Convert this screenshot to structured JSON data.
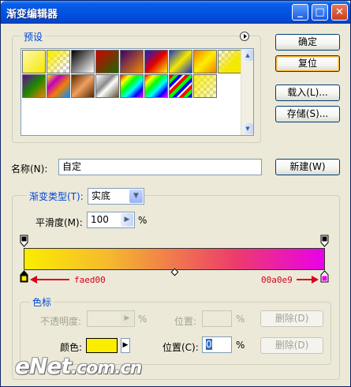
{
  "window": {
    "title": "渐变编辑器"
  },
  "titlebar_buttons": {
    "minimize": "_",
    "maximize": "□",
    "close": "✕"
  },
  "presets": {
    "title": "预设",
    "swatches_row1": [
      "fg-bg",
      "fg-transparent",
      "black-white",
      "red-green",
      "violet-orange",
      "blue-red-yellow",
      "blue-yellow-blue",
      "orange-yellow-orange",
      "yellow-transparent"
    ],
    "swatches_row2": [
      "violet-green-orange",
      "yellow-violet-orange-blue",
      "copper",
      "chrome",
      "rainbow",
      "transparent-rainbow",
      "transparent-stripes",
      "yellow-transparent-2"
    ]
  },
  "buttons": {
    "ok": "确定",
    "reset": "复位",
    "load": "载入(L)...",
    "save": "存储(S)...",
    "new": "新建(W)",
    "delete_opacity": "删除(D)",
    "delete_color": "删除(D)"
  },
  "name_field": {
    "label": "名称(N):",
    "value": "自定"
  },
  "gradient_type": {
    "label": "渐变类型(T):",
    "value": "实底"
  },
  "smoothness": {
    "label": "平滑度(M):",
    "value": "100",
    "unit": "%"
  },
  "gradient": {
    "left_color": "#faed00",
    "right_color": "#e900e9",
    "annotation_left": "faed00",
    "annotation_right": "00a0e9"
  },
  "color_stops": {
    "title": "色标",
    "opacity_label": "不透明度:",
    "opacity_unit": "%",
    "opacity_location_label": "位置:",
    "opacity_location_unit": "%",
    "color_label": "颜色:",
    "color_location_label": "位置(C):",
    "color_location_value": "0",
    "color_location_unit": "%",
    "color_value": "#faed00"
  },
  "watermark": {
    "main": "eNet",
    "suffix": ".com.cn"
  }
}
